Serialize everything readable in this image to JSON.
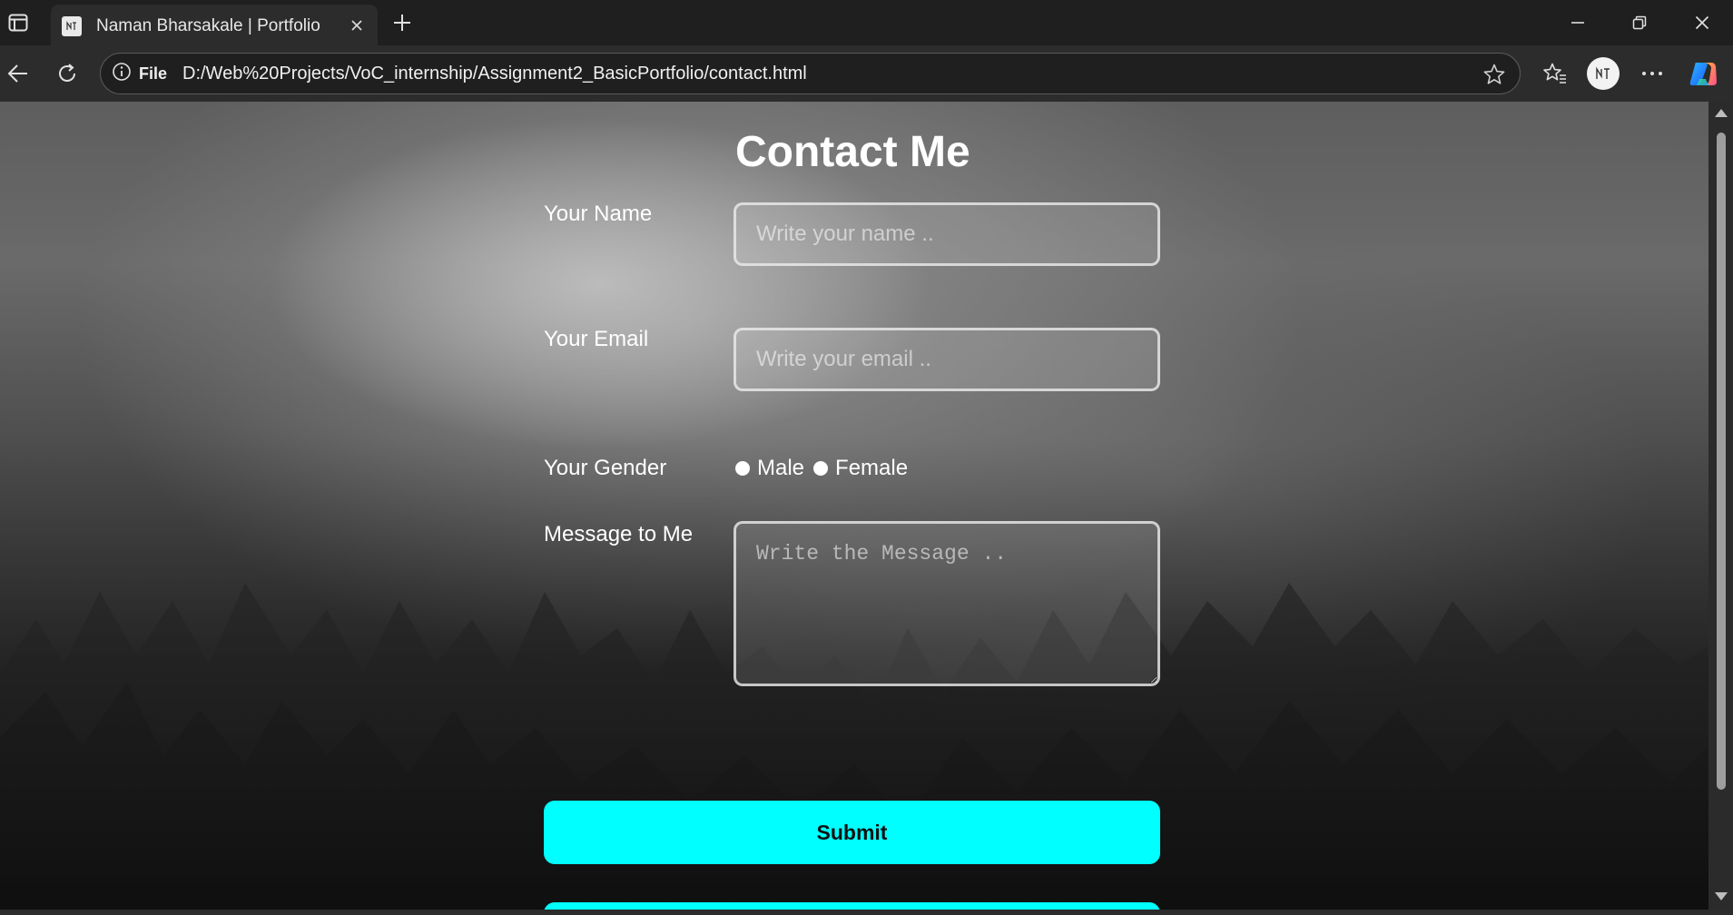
{
  "browser": {
    "tab": {
      "title": "Naman Bharsakale | Portfolio"
    },
    "address_bar": {
      "site_info_label": "File",
      "url": "D:/Web%20Projects/VoC_internship/Assignment2_BasicPortfolio/contact.html"
    },
    "icons": {
      "sidebar": "tab-actions-icon",
      "favicon": "site-favicon",
      "close_tab": "close-icon",
      "new_tab": "plus-icon",
      "minimize": "minimize-icon",
      "restore": "restore-icon",
      "close_window": "close-icon",
      "back": "back-arrow-icon",
      "refresh": "refresh-icon",
      "info": "info-icon",
      "favorite": "star-icon",
      "favorites": "favorites-icon",
      "profile": "profile-avatar",
      "more": "more-icon",
      "copilot": "copilot-icon"
    }
  },
  "page": {
    "heading": "Contact Me",
    "form": {
      "name": {
        "label": "Your Name",
        "placeholder": "Write your name ..",
        "value": ""
      },
      "email": {
        "label": "Your Email",
        "placeholder": "Write your email ..",
        "value": ""
      },
      "gender": {
        "label": "Your Gender",
        "options": [
          {
            "label": "Male",
            "selected": false
          },
          {
            "label": "Female",
            "selected": false
          }
        ]
      },
      "message": {
        "label": "Message to Me",
        "placeholder": "Write the Message ..",
        "value": ""
      },
      "submit_label": "Submit"
    },
    "colors": {
      "accent": "#00ffff",
      "text": "#ffffff"
    }
  }
}
